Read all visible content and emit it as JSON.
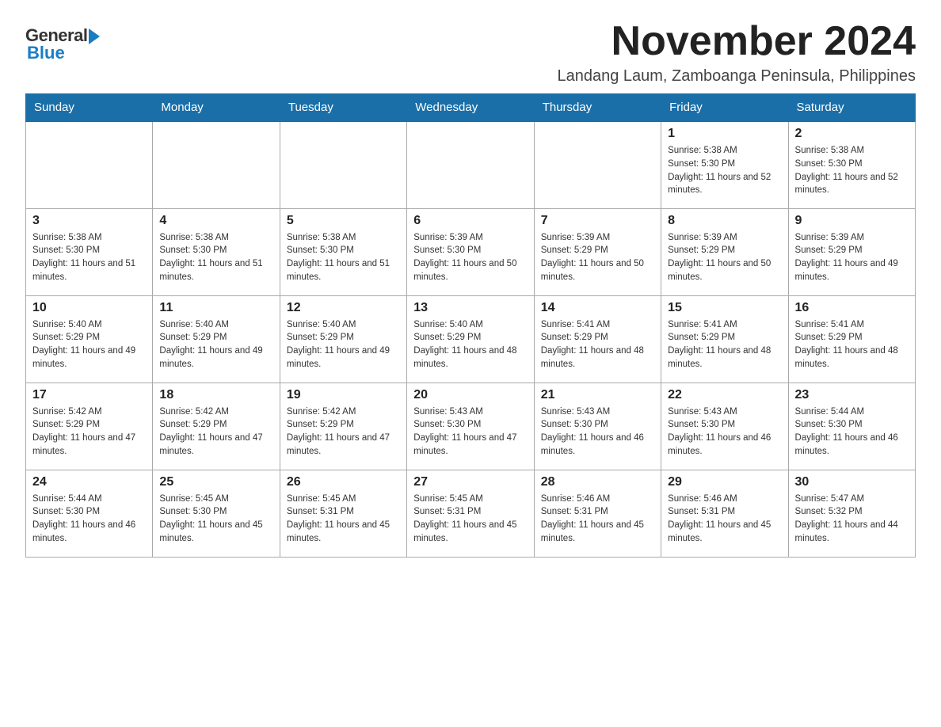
{
  "logo": {
    "general": "General",
    "blue": "Blue"
  },
  "header": {
    "month_year": "November 2024",
    "location": "Landang Laum, Zamboanga Peninsula, Philippines"
  },
  "days_of_week": [
    "Sunday",
    "Monday",
    "Tuesday",
    "Wednesday",
    "Thursday",
    "Friday",
    "Saturday"
  ],
  "weeks": [
    [
      {
        "day": "",
        "info": ""
      },
      {
        "day": "",
        "info": ""
      },
      {
        "day": "",
        "info": ""
      },
      {
        "day": "",
        "info": ""
      },
      {
        "day": "",
        "info": ""
      },
      {
        "day": "1",
        "info": "Sunrise: 5:38 AM\nSunset: 5:30 PM\nDaylight: 11 hours and 52 minutes."
      },
      {
        "day": "2",
        "info": "Sunrise: 5:38 AM\nSunset: 5:30 PM\nDaylight: 11 hours and 52 minutes."
      }
    ],
    [
      {
        "day": "3",
        "info": "Sunrise: 5:38 AM\nSunset: 5:30 PM\nDaylight: 11 hours and 51 minutes."
      },
      {
        "day": "4",
        "info": "Sunrise: 5:38 AM\nSunset: 5:30 PM\nDaylight: 11 hours and 51 minutes."
      },
      {
        "day": "5",
        "info": "Sunrise: 5:38 AM\nSunset: 5:30 PM\nDaylight: 11 hours and 51 minutes."
      },
      {
        "day": "6",
        "info": "Sunrise: 5:39 AM\nSunset: 5:30 PM\nDaylight: 11 hours and 50 minutes."
      },
      {
        "day": "7",
        "info": "Sunrise: 5:39 AM\nSunset: 5:29 PM\nDaylight: 11 hours and 50 minutes."
      },
      {
        "day": "8",
        "info": "Sunrise: 5:39 AM\nSunset: 5:29 PM\nDaylight: 11 hours and 50 minutes."
      },
      {
        "day": "9",
        "info": "Sunrise: 5:39 AM\nSunset: 5:29 PM\nDaylight: 11 hours and 49 minutes."
      }
    ],
    [
      {
        "day": "10",
        "info": "Sunrise: 5:40 AM\nSunset: 5:29 PM\nDaylight: 11 hours and 49 minutes."
      },
      {
        "day": "11",
        "info": "Sunrise: 5:40 AM\nSunset: 5:29 PM\nDaylight: 11 hours and 49 minutes."
      },
      {
        "day": "12",
        "info": "Sunrise: 5:40 AM\nSunset: 5:29 PM\nDaylight: 11 hours and 49 minutes."
      },
      {
        "day": "13",
        "info": "Sunrise: 5:40 AM\nSunset: 5:29 PM\nDaylight: 11 hours and 48 minutes."
      },
      {
        "day": "14",
        "info": "Sunrise: 5:41 AM\nSunset: 5:29 PM\nDaylight: 11 hours and 48 minutes."
      },
      {
        "day": "15",
        "info": "Sunrise: 5:41 AM\nSunset: 5:29 PM\nDaylight: 11 hours and 48 minutes."
      },
      {
        "day": "16",
        "info": "Sunrise: 5:41 AM\nSunset: 5:29 PM\nDaylight: 11 hours and 48 minutes."
      }
    ],
    [
      {
        "day": "17",
        "info": "Sunrise: 5:42 AM\nSunset: 5:29 PM\nDaylight: 11 hours and 47 minutes."
      },
      {
        "day": "18",
        "info": "Sunrise: 5:42 AM\nSunset: 5:29 PM\nDaylight: 11 hours and 47 minutes."
      },
      {
        "day": "19",
        "info": "Sunrise: 5:42 AM\nSunset: 5:29 PM\nDaylight: 11 hours and 47 minutes."
      },
      {
        "day": "20",
        "info": "Sunrise: 5:43 AM\nSunset: 5:30 PM\nDaylight: 11 hours and 47 minutes."
      },
      {
        "day": "21",
        "info": "Sunrise: 5:43 AM\nSunset: 5:30 PM\nDaylight: 11 hours and 46 minutes."
      },
      {
        "day": "22",
        "info": "Sunrise: 5:43 AM\nSunset: 5:30 PM\nDaylight: 11 hours and 46 minutes."
      },
      {
        "day": "23",
        "info": "Sunrise: 5:44 AM\nSunset: 5:30 PM\nDaylight: 11 hours and 46 minutes."
      }
    ],
    [
      {
        "day": "24",
        "info": "Sunrise: 5:44 AM\nSunset: 5:30 PM\nDaylight: 11 hours and 46 minutes."
      },
      {
        "day": "25",
        "info": "Sunrise: 5:45 AM\nSunset: 5:30 PM\nDaylight: 11 hours and 45 minutes."
      },
      {
        "day": "26",
        "info": "Sunrise: 5:45 AM\nSunset: 5:31 PM\nDaylight: 11 hours and 45 minutes."
      },
      {
        "day": "27",
        "info": "Sunrise: 5:45 AM\nSunset: 5:31 PM\nDaylight: 11 hours and 45 minutes."
      },
      {
        "day": "28",
        "info": "Sunrise: 5:46 AM\nSunset: 5:31 PM\nDaylight: 11 hours and 45 minutes."
      },
      {
        "day": "29",
        "info": "Sunrise: 5:46 AM\nSunset: 5:31 PM\nDaylight: 11 hours and 45 minutes."
      },
      {
        "day": "30",
        "info": "Sunrise: 5:47 AM\nSunset: 5:32 PM\nDaylight: 11 hours and 44 minutes."
      }
    ]
  ]
}
